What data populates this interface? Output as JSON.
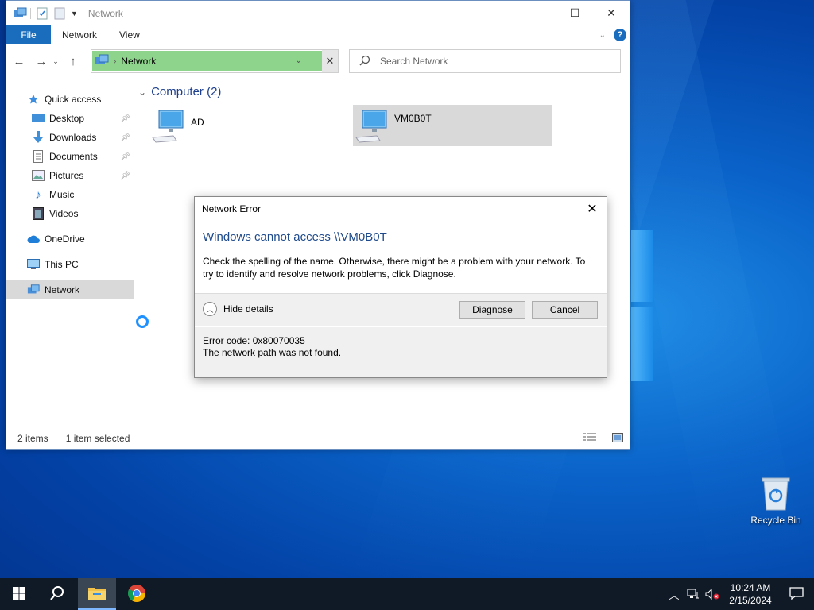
{
  "window": {
    "title": "Network",
    "controls": {
      "minimize": "—",
      "maximize": "☐",
      "close": "✕"
    }
  },
  "ribbon": {
    "tabs": [
      "File",
      "Network",
      "View"
    ],
    "help": "?"
  },
  "navigation": {
    "address_path": "Network",
    "search_placeholder": "Search Network"
  },
  "sidebar": {
    "items": [
      {
        "label": "Quick access",
        "icon": "star-icon"
      },
      {
        "label": "Desktop",
        "icon": "desktop-folder-icon",
        "pinned": true
      },
      {
        "label": "Downloads",
        "icon": "downloads-icon",
        "pinned": true
      },
      {
        "label": "Documents",
        "icon": "documents-icon",
        "pinned": true
      },
      {
        "label": "Pictures",
        "icon": "pictures-icon",
        "pinned": true
      },
      {
        "label": "Music",
        "icon": "music-icon"
      },
      {
        "label": "Videos",
        "icon": "videos-icon"
      },
      {
        "label": "OneDrive",
        "icon": "cloud-icon"
      },
      {
        "label": "This PC",
        "icon": "computer-icon"
      },
      {
        "label": "Network",
        "icon": "network-icon",
        "selected": true
      }
    ]
  },
  "content": {
    "group_header": "Computer (2)",
    "items": [
      {
        "label": "AD",
        "selected": false
      },
      {
        "label": "VM0B0T",
        "selected": true
      }
    ]
  },
  "status": {
    "count": "2 items",
    "selection": "1 item selected"
  },
  "dialog": {
    "title": "Network Error",
    "heading": "Windows cannot access \\\\VM0B0T",
    "message": "Check the spelling of the name. Otherwise, there might be a problem with your network. To try to identify and resolve network problems, click Diagnose.",
    "toggle_label": "Hide details",
    "diagnose_label": "Diagnose",
    "cancel_label": "Cancel",
    "error_code": "Error code: 0x80070035",
    "error_detail": "The network path was not found."
  },
  "desktop": {
    "recycle_bin_label": "Recycle Bin"
  },
  "taskbar": {
    "time": "10:24 AM",
    "date": "2/15/2024"
  },
  "colors": {
    "accent": "#1a6dbd",
    "address_highlight": "#8fd48c",
    "heading_blue": "#1e4a8c",
    "taskbar": "#101a26"
  }
}
